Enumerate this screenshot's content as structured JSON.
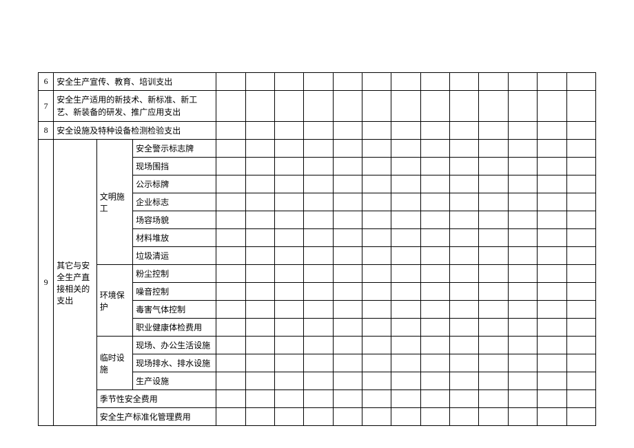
{
  "rows": {
    "r6": {
      "num": "6",
      "label": "安全生产宣传、教育、培训支出"
    },
    "r7": {
      "num": "7",
      "label": "安全生产适用的新技术、新标准、新工艺、新装备的研发、推广应用支出"
    },
    "r8": {
      "num": "8",
      "label": "安全设施及特种设备检测检验支出"
    },
    "r9": {
      "num": "9",
      "label": "其它与安全生产直接相关的支出",
      "groups": {
        "g1": {
          "label": "文明施工",
          "items": [
            "安全警示标志牌",
            "现场围挡",
            "公示标牌",
            "企业标志",
            "场容场貌",
            "材料堆放",
            "垃圾清运"
          ]
        },
        "g2": {
          "label": "环境保护",
          "items": [
            "粉尘控制",
            "噪音控制",
            "毒害气体控制",
            "职业健康体检费用"
          ]
        },
        "g3": {
          "label": "临时设施",
          "items": [
            "现场、办公生活设施",
            "现场排水、排水设施",
            "生产设施"
          ]
        },
        "g4": {
          "label": "季节性安全费用"
        },
        "g5": {
          "label": "安全生产标准化管理费用"
        }
      }
    }
  }
}
